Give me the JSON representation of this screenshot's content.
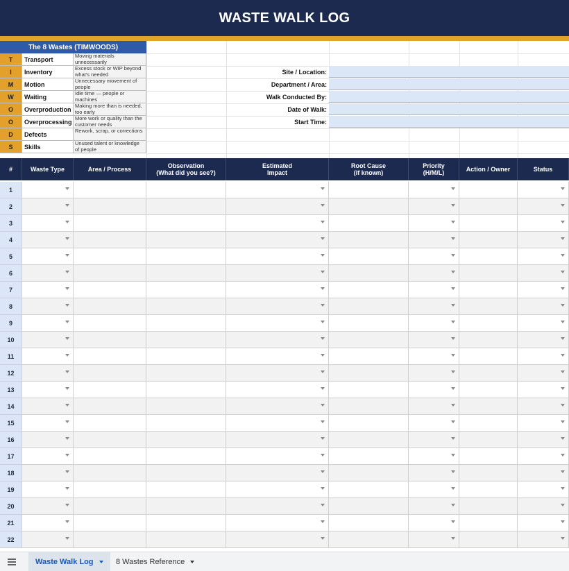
{
  "title": "WASTE WALK LOG",
  "legend": {
    "heading": "The 8 Wastes (TIMWOODS)",
    "items": [
      {
        "letter": "T",
        "name": "Transport",
        "desc": "Moving materials unnecessarily"
      },
      {
        "letter": "I",
        "name": "Inventory",
        "desc": "Excess stock or WIP beyond what's needed"
      },
      {
        "letter": "M",
        "name": "Motion",
        "desc": "Unnecessary movement of people"
      },
      {
        "letter": "W",
        "name": "Waiting",
        "desc": "Idle time — people or machines"
      },
      {
        "letter": "O",
        "name": "Overproduction",
        "desc": "Making more than is needed, too early"
      },
      {
        "letter": "O",
        "name": "Overprocessing",
        "desc": "More work or quality than the customer needs"
      },
      {
        "letter": "D",
        "name": "Defects",
        "desc": "Rework, scrap, or corrections"
      },
      {
        "letter": "S",
        "name": "Skills",
        "desc": "Unused talent or knowledge of people"
      }
    ]
  },
  "fields": [
    {
      "label": "Site / Location:",
      "value": ""
    },
    {
      "label": "Department / Area:",
      "value": ""
    },
    {
      "label": "Walk Conducted By:",
      "value": ""
    },
    {
      "label": "Date of Walk:",
      "value": ""
    },
    {
      "label": "Start Time:",
      "value": ""
    }
  ],
  "table": {
    "headers": [
      "#",
      "Waste Type",
      "Area / Process",
      "Observation\n(What did you see?)",
      "Estimated\nImpact",
      "Root Cause\n(if known)",
      "Priority\n(H/M/L)",
      "Action / Owner",
      "Status"
    ],
    "dropdown_columns": [
      1,
      4,
      6,
      8
    ],
    "rows": [
      "1",
      "2",
      "3",
      "4",
      "5",
      "6",
      "7",
      "8",
      "9",
      "10",
      "11",
      "12",
      "13",
      "14",
      "15",
      "16",
      "17",
      "18",
      "19",
      "20",
      "21",
      "22"
    ]
  },
  "sheet_tabs": [
    {
      "label": "Waste Walk Log",
      "active": true
    },
    {
      "label": "8 Wastes Reference",
      "active": false
    }
  ],
  "colors": {
    "header_navy": "#1b2a4e",
    "accent_gold": "#e0a526",
    "legend_blue": "#2e5aa8",
    "input_blue": "#dbe6f6"
  }
}
